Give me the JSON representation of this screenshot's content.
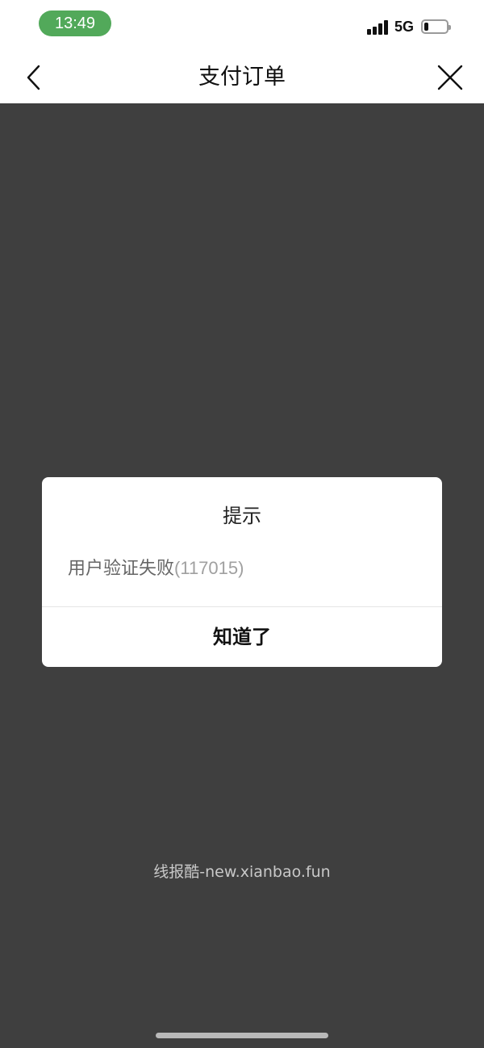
{
  "status_bar": {
    "time": "13:49",
    "network": "5G",
    "battery_level": 0.2,
    "colors": {
      "time_pill": "#52a95a"
    }
  },
  "nav": {
    "title": "支付订单",
    "back_icon": "chevron-left-icon",
    "close_icon": "close-icon"
  },
  "dialog": {
    "title": "提示",
    "message": "用户验证失败",
    "code": "(117015)",
    "confirm_label": "知道了"
  },
  "watermark": "线报酷-new.xianbao.fun",
  "colors": {
    "overlay": "#3f3f3f",
    "dialog_bg": "#ffffff"
  }
}
